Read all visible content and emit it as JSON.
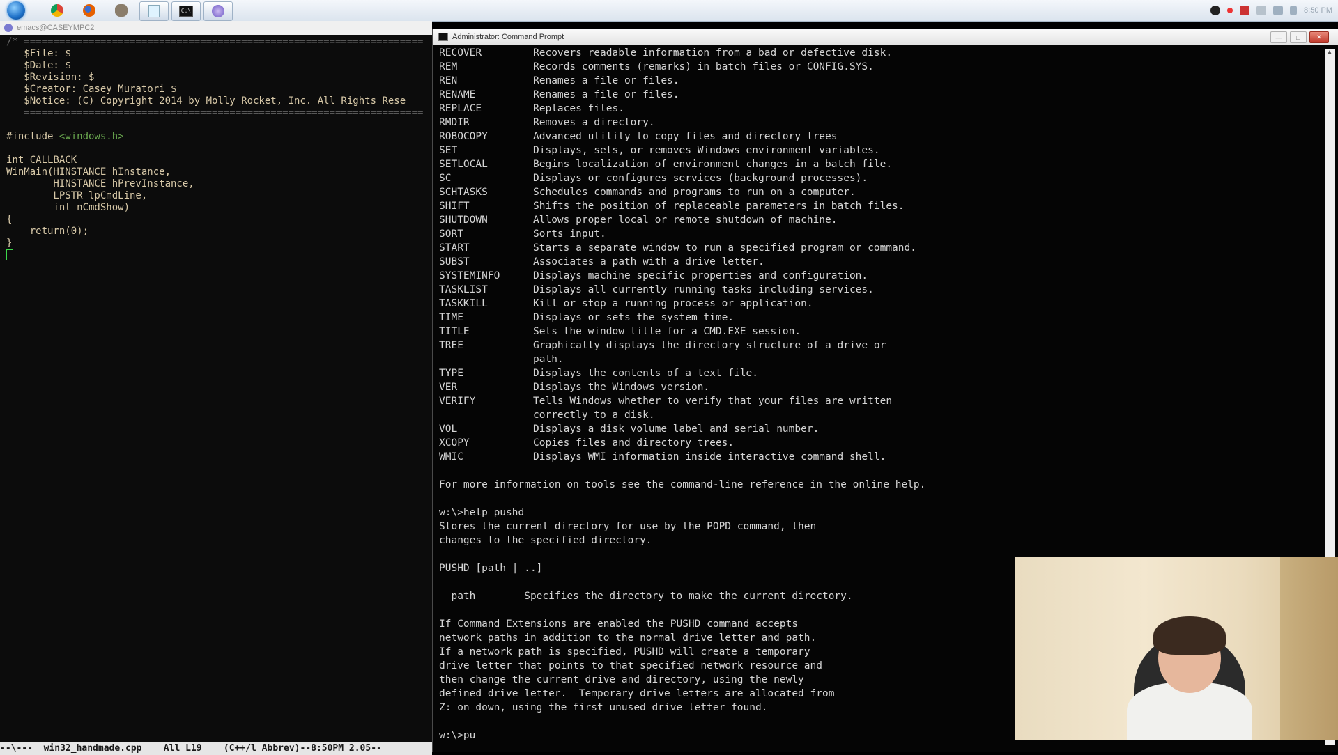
{
  "taskbar": {
    "clock": "8:50 PM",
    "apps": [
      "chrome",
      "firefox",
      "gimp",
      "notepad",
      "command-prompt",
      "emacs"
    ]
  },
  "emacs": {
    "title": "emacs@CASEYMPC2",
    "lines": [
      {
        "t": "/* ========================================================================",
        "c": "dim"
      },
      {
        "t": "   $File: $",
        "c": ""
      },
      {
        "t": "   $Date: $",
        "c": ""
      },
      {
        "t": "   $Revision: $",
        "c": ""
      },
      {
        "t": "   $Creator: Casey Muratori $",
        "c": ""
      },
      {
        "t": "   $Notice: (C) Copyright 2014 by Molly Rocket, Inc. All Rights Rese",
        "c": ""
      },
      {
        "t": "   ========================================================================",
        "c": "dim"
      },
      {
        "t": "",
        "c": ""
      },
      {
        "t": "#include ",
        "c": "",
        "str": "<windows.h>"
      },
      {
        "t": "",
        "c": ""
      },
      {
        "t": "int CALLBACK",
        "c": ""
      },
      {
        "t": "WinMain(HINSTANCE hInstance,",
        "c": ""
      },
      {
        "t": "        HINSTANCE hPrevInstance,",
        "c": ""
      },
      {
        "t": "        LPSTR lpCmdLine,",
        "c": ""
      },
      {
        "t": "        int nCmdShow)",
        "c": ""
      },
      {
        "t": "{",
        "c": ""
      },
      {
        "t": "    return(0);",
        "c": ""
      },
      {
        "t": "}",
        "c": ""
      }
    ],
    "modeline": "--\\---  win32_handmade.cpp    All L19    (C++/l Abbrev)--8:50PM 2.05--"
  },
  "cmd": {
    "title": "Administrator: Command Prompt",
    "help_rows": [
      {
        "cmd": "RECOVER",
        "desc": "Recovers readable information from a bad or defective disk."
      },
      {
        "cmd": "REM",
        "desc": "Records comments (remarks) in batch files or CONFIG.SYS."
      },
      {
        "cmd": "REN",
        "desc": "Renames a file or files."
      },
      {
        "cmd": "RENAME",
        "desc": "Renames a file or files."
      },
      {
        "cmd": "REPLACE",
        "desc": "Replaces files."
      },
      {
        "cmd": "RMDIR",
        "desc": "Removes a directory."
      },
      {
        "cmd": "ROBOCOPY",
        "desc": "Advanced utility to copy files and directory trees"
      },
      {
        "cmd": "SET",
        "desc": "Displays, sets, or removes Windows environment variables."
      },
      {
        "cmd": "SETLOCAL",
        "desc": "Begins localization of environment changes in a batch file."
      },
      {
        "cmd": "SC",
        "desc": "Displays or configures services (background processes)."
      },
      {
        "cmd": "SCHTASKS",
        "desc": "Schedules commands and programs to run on a computer."
      },
      {
        "cmd": "SHIFT",
        "desc": "Shifts the position of replaceable parameters in batch files."
      },
      {
        "cmd": "SHUTDOWN",
        "desc": "Allows proper local or remote shutdown of machine."
      },
      {
        "cmd": "SORT",
        "desc": "Sorts input."
      },
      {
        "cmd": "START",
        "desc": "Starts a separate window to run a specified program or command."
      },
      {
        "cmd": "SUBST",
        "desc": "Associates a path with a drive letter."
      },
      {
        "cmd": "SYSTEMINFO",
        "desc": "Displays machine specific properties and configuration."
      },
      {
        "cmd": "TASKLIST",
        "desc": "Displays all currently running tasks including services."
      },
      {
        "cmd": "TASKKILL",
        "desc": "Kill or stop a running process or application."
      },
      {
        "cmd": "TIME",
        "desc": "Displays or sets the system time."
      },
      {
        "cmd": "TITLE",
        "desc": "Sets the window title for a CMD.EXE session."
      },
      {
        "cmd": "TREE",
        "desc": "Graphically displays the directory structure of a drive or"
      },
      {
        "cmd": "",
        "desc": "path."
      },
      {
        "cmd": "TYPE",
        "desc": "Displays the contents of a text file."
      },
      {
        "cmd": "VER",
        "desc": "Displays the Windows version."
      },
      {
        "cmd": "VERIFY",
        "desc": "Tells Windows whether to verify that your files are written"
      },
      {
        "cmd": "",
        "desc": "correctly to a disk."
      },
      {
        "cmd": "VOL",
        "desc": "Displays a disk volume label and serial number."
      },
      {
        "cmd": "XCOPY",
        "desc": "Copies files and directory trees."
      },
      {
        "cmd": "WMIC",
        "desc": "Displays WMI information inside interactive command shell."
      }
    ],
    "tail_lines": [
      "",
      "For more information on tools see the command-line reference in the online help.",
      "",
      "w:\\>help pushd",
      "Stores the current directory for use by the POPD command, then",
      "changes to the specified directory.",
      "",
      "PUSHD [path | ..]",
      "",
      "  path        Specifies the directory to make the current directory.",
      "",
      "If Command Extensions are enabled the PUSHD command accepts",
      "network paths in addition to the normal drive letter and path.",
      "If a network path is specified, PUSHD will create a temporary",
      "drive letter that points to that specified network resource and",
      "then change the current drive and directory, using the newly",
      "defined drive letter.  Temporary drive letters are allocated from",
      "Z: on down, using the first unused drive letter found.",
      "",
      "w:\\>pu"
    ]
  }
}
